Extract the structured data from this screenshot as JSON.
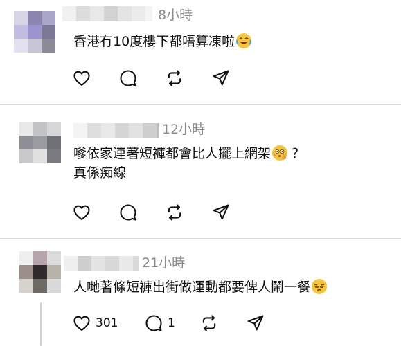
{
  "posts": [
    {
      "timestamp": "8小時",
      "text": "香港冇10度樓下都唔算凍啦",
      "emoji": "laughing-crying-emoji",
      "actions": {
        "like_count": "",
        "reply_count": ""
      }
    },
    {
      "timestamp": "12小時",
      "text_line1": "嗲依家連著短褲都會比人擺上網架",
      "text_line1_suffix": "？",
      "text_line2": "真係痴線",
      "emoji": "flushed-thinking-emoji",
      "actions": {
        "like_count": "",
        "reply_count": ""
      }
    },
    {
      "timestamp": "21小時",
      "text": "人哋著條短褲出街做運動都要俾人鬧一餐",
      "emoji": "pensive-face-emoji",
      "actions": {
        "like_count": "301",
        "reply_count": "1"
      }
    }
  ],
  "icons": {
    "like": "heart-icon",
    "reply": "speech-bubble-icon",
    "repost": "repost-arrows-icon",
    "share": "send-paper-plane-icon"
  },
  "colors": {
    "timestamp": "#8a8a8a",
    "divider": "#d9d9d9",
    "emoji": "#f7c53a"
  }
}
